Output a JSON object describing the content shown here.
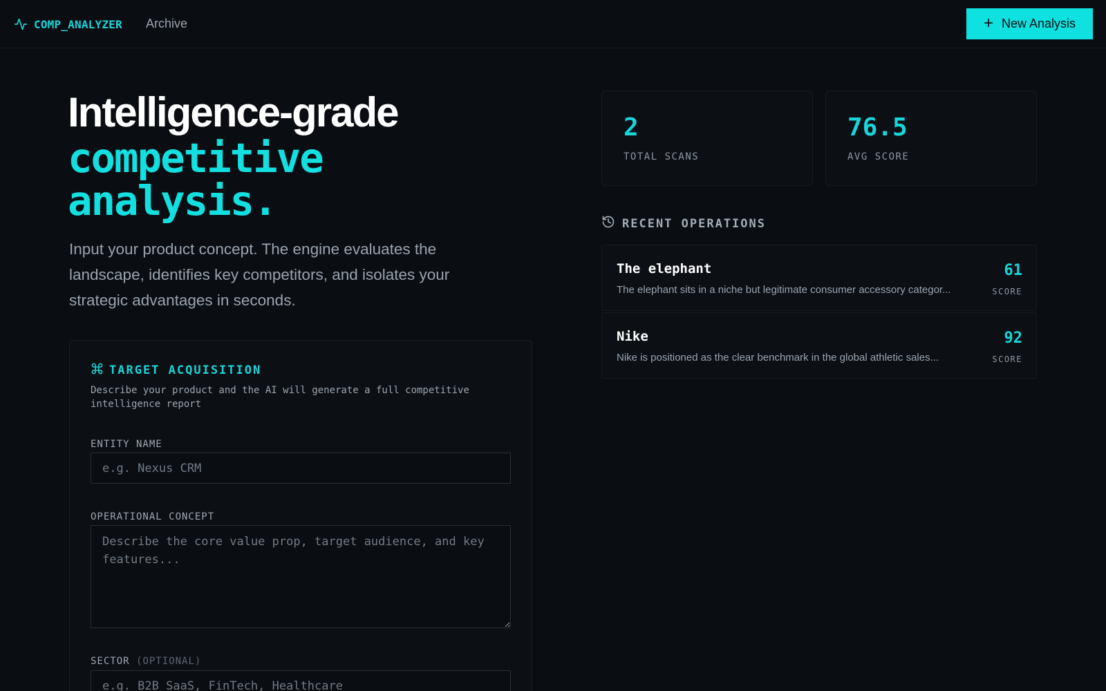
{
  "header": {
    "brand": "COMP_ANALYZER",
    "nav_archive": "Archive",
    "new_button": "New Analysis",
    "icons": {
      "brand": "activity-pulse-icon",
      "new_button": "plus-icon"
    }
  },
  "hero": {
    "title_line1": "Intelligence-grade",
    "title_line2": "competitive analysis.",
    "description": "Input your product concept. The engine evaluates the landscape, identifies key competitors, and isolates your strategic advantages in seconds."
  },
  "form": {
    "title": "TARGET ACQUISITION",
    "icon": "command-icon",
    "subtitle": "Describe your product and the AI will generate a full competitive intelligence report",
    "entity_label": "ENTITY NAME",
    "entity_placeholder": "e.g. Nexus CRM",
    "entity_value": "",
    "concept_label": "OPERATIONAL CONCEPT",
    "concept_placeholder": "Describe the core value prop, target audience, and key features...",
    "concept_value": "",
    "sector_label": "SECTOR",
    "sector_optional": "(OPTIONAL)",
    "sector_placeholder": "e.g. B2B SaaS, FinTech, Healthcare",
    "sector_value": ""
  },
  "stats": {
    "total_scans_value": "2",
    "total_scans_label": "TOTAL SCANS",
    "avg_score_value": "76.5",
    "avg_score_label": "AVG SCORE"
  },
  "recent": {
    "title": "RECENT OPERATIONS",
    "icon": "history-icon",
    "items": [
      {
        "name": "The elephant",
        "description": "The elephant sits in a niche but legitimate consumer accessory categor...",
        "score": "61",
        "score_label": "SCORE"
      },
      {
        "name": "Nike",
        "description": "Nike is positioned as the clear benchmark in the global athletic sales...",
        "score": "92",
        "score_label": "SCORE"
      }
    ]
  },
  "colors": {
    "background": "#0a0e13",
    "accent": "#14dfe0",
    "card": "#0c1015",
    "muted_text": "#9aa3ad"
  }
}
